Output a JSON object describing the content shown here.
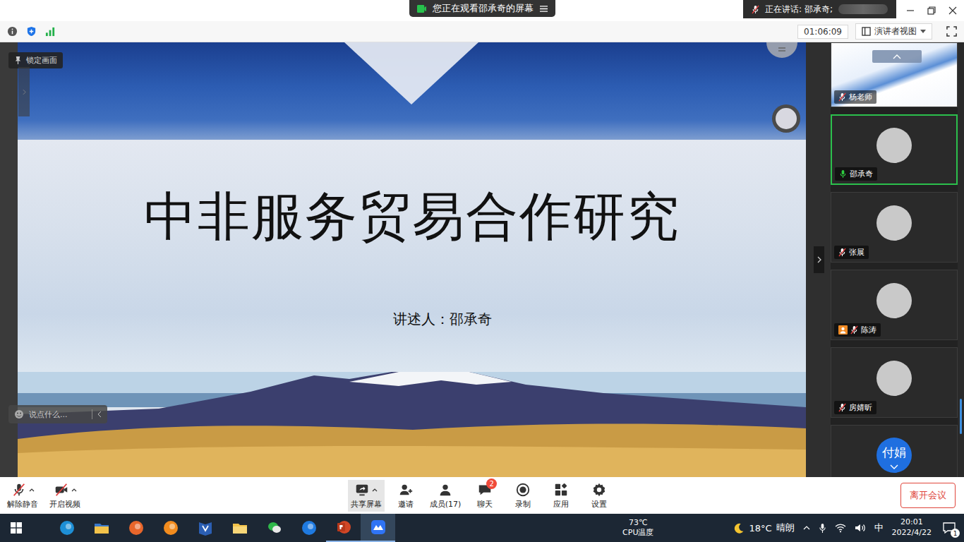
{
  "topbar": {
    "viewing": "您正在观看邵承奇的屏幕",
    "speaking": "正在讲话: 邵承奇;"
  },
  "infobar": {
    "elapsed": "01:06:09",
    "view": "演讲者视图"
  },
  "lock_button": "锁定画面",
  "slide": {
    "title": "中非服务贸易合作研究",
    "presenter": "讲述人：邵承奇"
  },
  "chat_input": {
    "placeholder": "说点什么..."
  },
  "participants": [
    {
      "name": "杨老师",
      "kind": "screen",
      "muted": true,
      "speaking": false,
      "host": false
    },
    {
      "name": "邵承奇",
      "kind": "avatar",
      "muted": false,
      "speaking": true,
      "host": false
    },
    {
      "name": "张展",
      "kind": "avatar",
      "muted": true,
      "speaking": false,
      "host": false
    },
    {
      "name": "陈涛",
      "kind": "avatar",
      "muted": true,
      "speaking": false,
      "host": true
    },
    {
      "name": "房婧昕",
      "kind": "avatar",
      "muted": true,
      "speaking": false,
      "host": false
    },
    {
      "kind": "text",
      "avatar_text": "付娟",
      "muted": true,
      "speaking": false,
      "host": false
    }
  ],
  "toolbar": {
    "left": [
      {
        "label": "解除静音",
        "kind": "mic-off",
        "menu": true,
        "selected": false
      },
      {
        "label": "开启视频",
        "kind": "video-off",
        "menu": true,
        "selected": false
      }
    ],
    "center": [
      {
        "label": "共享屏幕",
        "kind": "share",
        "menu": true,
        "selected": true
      },
      {
        "label": "邀请",
        "kind": "invite",
        "menu": false,
        "selected": false
      },
      {
        "label": "成员(17)",
        "kind": "members",
        "menu": false,
        "selected": false
      },
      {
        "label": "聊天",
        "kind": "chat",
        "menu": false,
        "selected": false,
        "badge": "2"
      },
      {
        "label": "录制",
        "kind": "record",
        "menu": false,
        "selected": false
      },
      {
        "label": "应用",
        "kind": "apps",
        "menu": false,
        "selected": false
      },
      {
        "label": "设置",
        "kind": "settings",
        "menu": false,
        "selected": false
      }
    ],
    "leave": "离开会议"
  },
  "taskbar": {
    "apps": [
      {
        "kind": "edge",
        "running": false,
        "active": false
      },
      {
        "kind": "explorer",
        "running": false,
        "active": false
      },
      {
        "kind": "firefox",
        "running": false,
        "active": false
      },
      {
        "kind": "orange",
        "running": false,
        "active": false
      },
      {
        "kind": "visio",
        "running": false,
        "active": false
      },
      {
        "kind": "folder",
        "running": false,
        "active": false
      },
      {
        "kind": "wechat",
        "running": false,
        "active": false
      },
      {
        "kind": "blue",
        "running": false,
        "active": false
      },
      {
        "kind": "powerpoint",
        "running": true,
        "active": false
      },
      {
        "kind": "meeting",
        "running": true,
        "active": true
      }
    ],
    "cpu": {
      "value": "73℃",
      "label": "CPU温度"
    },
    "weather": {
      "temp": "18°C",
      "condition": "晴朗"
    },
    "ime": "中",
    "time": "20:01",
    "date": "2022/4/22",
    "notifications": "1"
  }
}
